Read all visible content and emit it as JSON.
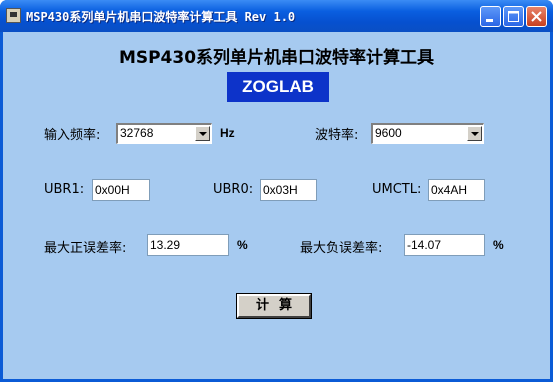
{
  "window": {
    "title": "MSP430系列单片机串口波特率计算工具 Rev 1.0"
  },
  "main": {
    "heading": "MSP430系列单片机串口波特率计算工具",
    "logo": "ZOGLAB"
  },
  "input_freq": {
    "label": "输入频率:",
    "value": "32768",
    "unit": "Hz"
  },
  "baud": {
    "label": "波特率:",
    "value": "9600"
  },
  "ubr1": {
    "label": "UBR1:",
    "value": "0x00H"
  },
  "ubr0": {
    "label": "UBR0:",
    "value": "0x03H"
  },
  "umctl": {
    "label": "UMCTL:",
    "value": "0x4AH"
  },
  "max_pos_err": {
    "label": "最大正误差率:",
    "value": "13.29",
    "unit": "%"
  },
  "max_neg_err": {
    "label": "最大负误差率:",
    "value": "-14.07",
    "unit": "%"
  },
  "calc_button": {
    "label": "计算"
  },
  "colors": {
    "client_bg": "#a6caf0",
    "title_bar": "#0a5fe0",
    "logo_bg": "#0d33c9"
  }
}
